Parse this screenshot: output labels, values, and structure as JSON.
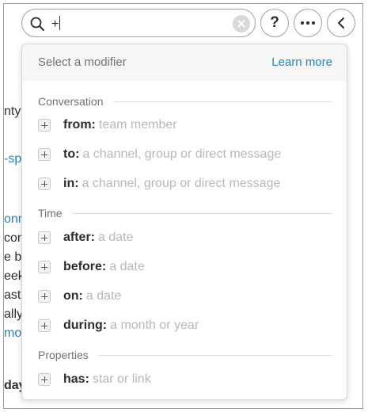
{
  "search": {
    "query": "+"
  },
  "toolbar": {
    "help_label": "?"
  },
  "background": {
    "fragments": [
      {
        "text": "nty",
        "style": "plain"
      },
      {
        "text": "-sp",
        "style": "link"
      },
      {
        "text": "onn",
        "style": "link"
      },
      {
        "text": "con",
        "style": "plain"
      },
      {
        "text": "e b",
        "style": "plain"
      },
      {
        "text": "eek",
        "style": "plain"
      },
      {
        "text": "ast",
        "style": "plain"
      },
      {
        "text": "ally",
        "style": "plain"
      },
      {
        "text": "mo",
        "style": "link"
      },
      {
        "text": "day",
        "style": "bold"
      }
    ]
  },
  "dropdown": {
    "title": "Select a modifier",
    "learn_more": "Learn more",
    "sections": [
      {
        "label": "Conversation",
        "items": [
          {
            "keyword": "from:",
            "hint": "team member"
          },
          {
            "keyword": "to:",
            "hint": "a channel, group or direct message"
          },
          {
            "keyword": "in:",
            "hint": "a channel, group or direct message"
          }
        ]
      },
      {
        "label": "Time",
        "items": [
          {
            "keyword": "after:",
            "hint": "a date"
          },
          {
            "keyword": "before:",
            "hint": "a date"
          },
          {
            "keyword": "on:",
            "hint": "a date"
          },
          {
            "keyword": "during:",
            "hint": "a month or year"
          }
        ]
      },
      {
        "label": "Properties",
        "items": [
          {
            "keyword": "has:",
            "hint": "star or link"
          }
        ]
      }
    ]
  },
  "icons": {
    "search": "search-icon",
    "clear": "clear-icon",
    "more": "more-icon",
    "back": "chevron-left-icon",
    "add": "plus-icon"
  }
}
